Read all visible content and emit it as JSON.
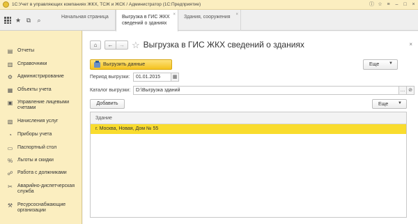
{
  "window": {
    "title": "1С:Учет в управляющих компаниях ЖКХ, ТСЖ и ЖСК / Администратор  (1С:Предприятие)"
  },
  "tabs": [
    {
      "label": "Начальная страница"
    },
    {
      "label": "Выгрузка в ГИС ЖКХ сведений о зданиях"
    },
    {
      "label": "Здания, сооружения"
    }
  ],
  "sidebar": {
    "items": [
      {
        "label": "Отчеты",
        "icon": "report-icon"
      },
      {
        "label": "Справочники",
        "icon": "book-icon"
      },
      {
        "label": "Администрирование",
        "icon": "gear-icon"
      },
      {
        "label": "Объекты учета",
        "icon": "building-icon"
      },
      {
        "label": "Управление лицевыми счетами",
        "icon": "accounts-icon"
      },
      {
        "label": "Начисления услуг",
        "icon": "charges-icon"
      },
      {
        "label": "Приборы учета",
        "icon": "meter-icon"
      },
      {
        "label": "Паспортный стол",
        "icon": "passport-icon"
      },
      {
        "label": "Льготы и скидки",
        "icon": "percent-icon"
      },
      {
        "label": "Работа с должниками",
        "icon": "debtors-icon"
      },
      {
        "label": "Аварийно-диспетчерская служба",
        "icon": "tools-icon"
      },
      {
        "label": "Ресурсоснабжающие организации",
        "icon": "supply-icon"
      }
    ]
  },
  "form": {
    "title": "Выгрузка в ГИС ЖКХ сведений о зданиях",
    "upload_label": "Выгрузить данные",
    "more_label": "Еще",
    "period_label": "Период выгрузки:",
    "period_value": "01.01.2015",
    "catalog_label": "Каталог выгрузки:",
    "catalog_value": "D:\\Выгрузка зданий",
    "add_label": "Добавить",
    "table_more_label": "Еще",
    "table": {
      "header": "Здание",
      "rows": [
        "г. Москва, Новая, Дом № 55"
      ]
    }
  },
  "colors": {
    "accent": "#f9dc2e",
    "sidebar_bg": "#fbeec0"
  }
}
